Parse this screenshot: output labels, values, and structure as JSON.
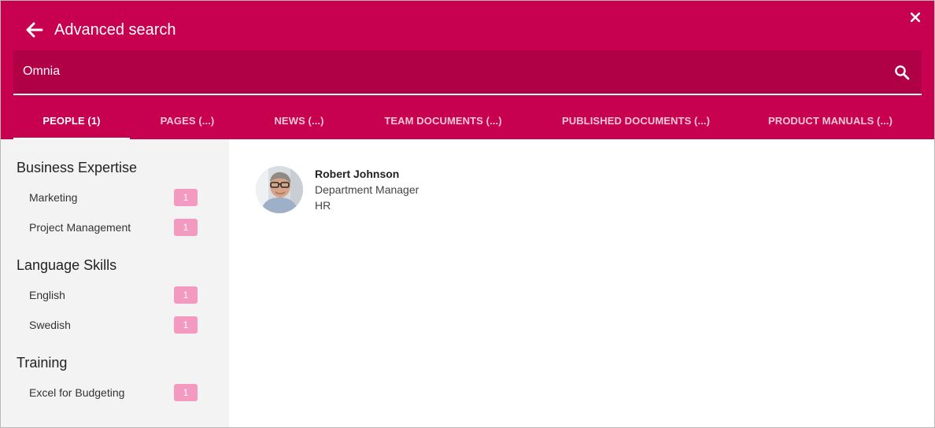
{
  "header": {
    "title": "Advanced search",
    "back_icon": "arrow-left-icon",
    "close_icon": "close-icon",
    "background": "#c7004f"
  },
  "search": {
    "value": "Omnia",
    "placeholder": "",
    "icon": "search-icon"
  },
  "tabs": [
    {
      "label": "PEOPLE (1)",
      "active": true
    },
    {
      "label": "PAGES (...)",
      "active": false
    },
    {
      "label": "NEWS (...)",
      "active": false
    },
    {
      "label": "TEAM DOCUMENTS (...)",
      "active": false
    },
    {
      "label": "PUBLISHED DOCUMENTS (...)",
      "active": false
    },
    {
      "label": "PRODUCT MANUALS (...)",
      "active": false
    }
  ],
  "refiners": [
    {
      "title": "Business Expertise",
      "items": [
        {
          "label": "Marketing",
          "count": "1"
        },
        {
          "label": "Project Management",
          "count": "1"
        }
      ]
    },
    {
      "title": "Language Skills",
      "items": [
        {
          "label": "English",
          "count": "1"
        },
        {
          "label": "Swedish",
          "count": "1"
        }
      ]
    },
    {
      "title": "Training",
      "items": [
        {
          "label": "Excel for Budgeting",
          "count": "1"
        }
      ]
    }
  ],
  "results": [
    {
      "name": "Robert Johnson",
      "title": "Department Manager",
      "department": "HR"
    }
  ],
  "colors": {
    "accent": "#c7004f",
    "search_bg": "#b00046",
    "badge": "#f49ac0",
    "sidebar_bg": "#f3f3f3"
  }
}
